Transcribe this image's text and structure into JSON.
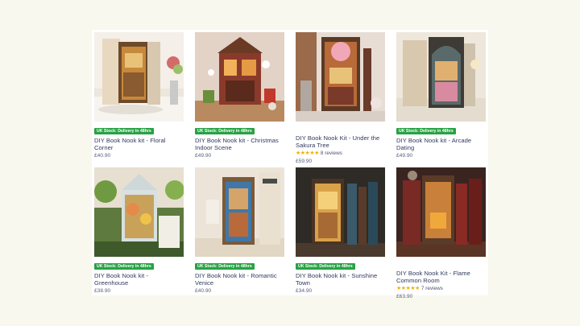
{
  "products": [
    {
      "badge": "UK Stock: Delivery in 48hrs",
      "title": "DIY Book Nook kit - Floral Corner",
      "price": "£40.90",
      "rating": null
    },
    {
      "badge": "UK Stock: Delivery in 48hrs",
      "title": "DIY Book Nook kit - Christmas Indoor Scene",
      "price": "£49.90",
      "rating": null
    },
    {
      "badge": null,
      "title": "DIY Book Nook Kit - Under the Sakura Tree",
      "price": "£59.90",
      "rating": {
        "stars": "★★★★★",
        "reviews": "8 reviews"
      }
    },
    {
      "badge": "UK Stock: Delivery in 48hrs",
      "title": "DIY Book Nook kit - Arcade Dating",
      "price": "£49.90",
      "rating": null
    },
    {
      "badge": "UK Stock: Delivery in 48hrs",
      "title": "DIY Book Nook kit - Greenhouse",
      "price": "£38.90",
      "rating": null
    },
    {
      "badge": "UK Stock: Delivery in 48hrs",
      "title": "DIY Book Nook kit - Romantic Venice",
      "price": "£40.90",
      "rating": null
    },
    {
      "badge": "UK Stock: Delivery in 48hrs",
      "title": "DIY Book Nook kit - Sunshine Town",
      "price": "£34.90",
      "rating": null
    },
    {
      "badge": null,
      "title": "DIY Book Nook Kit - Flame Common Room",
      "price": "£63.90",
      "rating": {
        "stars": "★★★★★",
        "reviews": "7 reviews"
      }
    }
  ],
  "colors": {
    "badge_green": "#27a244",
    "star": "#f0b400",
    "title": "#2f3a5e",
    "background": "#f8f8ee"
  }
}
